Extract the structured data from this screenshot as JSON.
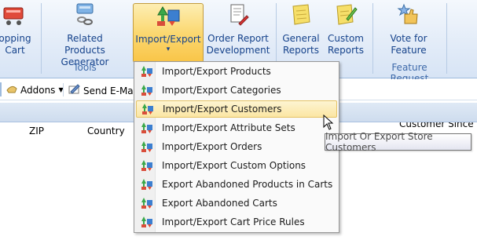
{
  "ribbon": {
    "shopping_cart_line1": "opping",
    "shopping_cart_line2": "Cart",
    "related_products_line1": "Related Products",
    "related_products_line2": "Generator",
    "import_export_label": "Import/Export",
    "import_export_arrow": "▾",
    "order_report_line1": "Order Report",
    "order_report_line2": "Development",
    "general_reports_line1": "General",
    "general_reports_line2": "Reports",
    "custom_reports_line1": "Custom",
    "custom_reports_line2": "Reports",
    "vote_line1": "Vote for",
    "vote_line2": "Feature",
    "group_tools": "Tools",
    "group_feature_request": "Feature Request"
  },
  "toolbar": {
    "addons_label": "Addons",
    "send_email_label": "Send E-Mail"
  },
  "grid": {
    "col_zip": "ZIP",
    "col_country": "Country",
    "col_partial": "Customer Since"
  },
  "menu": {
    "items": [
      {
        "label": "Import/Export Products"
      },
      {
        "label": "Import/Export Categories"
      },
      {
        "label": "Import/Export Customers"
      },
      {
        "label": "Import/Export Attribute Sets"
      },
      {
        "label": "Import/Export Orders"
      },
      {
        "label": "Import/Export Custom Options"
      },
      {
        "label": "Export Abandoned Products in Carts"
      },
      {
        "label": "Export Abandoned Carts"
      },
      {
        "label": "Import/Export Cart Price Rules"
      }
    ],
    "highlighted_index": 2
  },
  "tooltip": {
    "text": "Import Or Export Store Customers"
  },
  "colors": {
    "accent": "#fbd871",
    "ribbon_text": "#15428b"
  }
}
